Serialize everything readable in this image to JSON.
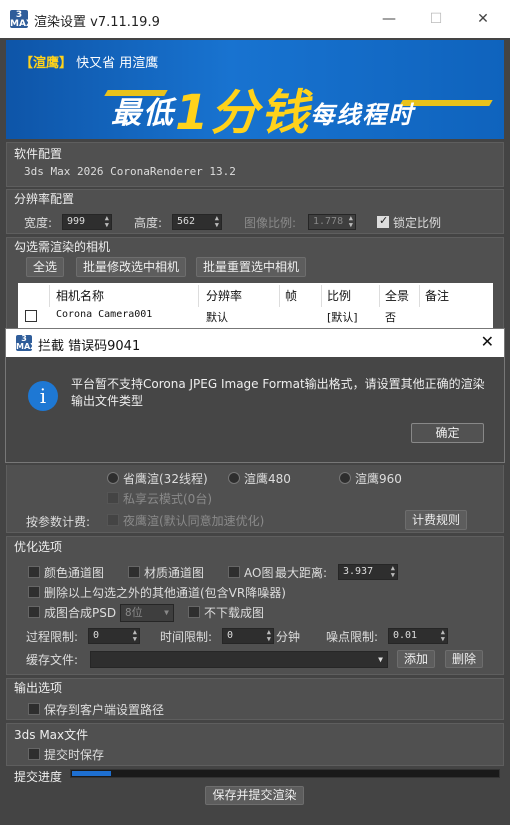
{
  "window": {
    "title": "渲染设置 v7.11.19.9",
    "minimize": "—",
    "maximize": "☐",
    "close": "✕",
    "logo": "3 MAX"
  },
  "banner": {
    "tagline_bracket": "【渲鹰】",
    "tagline": "快又省 用渲鹰",
    "main_prefix": "最低",
    "main_big": "1分钱",
    "main_suffix": "每线程时"
  },
  "software": {
    "title": "软件配置",
    "value": "3ds Max 2026  CoronaRenderer 13.2"
  },
  "resolution": {
    "title": "分辨率配置",
    "width_label": "宽度:",
    "width": "999",
    "height_label": "高度:",
    "height": "562",
    "ratio_label": "图像比例:",
    "ratio": "1.778",
    "lock_label": "锁定比例",
    "lock_checked": true
  },
  "cameras": {
    "title": "勾选需渲染的相机",
    "select_all": "全选",
    "batch_modify": "批量修改选中相机",
    "batch_reset": "批量重置选中相机",
    "columns": [
      "相机名称",
      "分辨率",
      "帧",
      "比例",
      "全景",
      "备注"
    ],
    "rows": [
      {
        "name": "Corona Camera001",
        "resolution": "默认",
        "frame": "",
        "ratio": "[默认]",
        "panorama": "否",
        "note": ""
      }
    ]
  },
  "dialog": {
    "title": "拦截 错误码9041",
    "message": "平台暂不支持Corona JPEG Image Format输出格式，请设置其他正确的渲染输出文件类型",
    "ok": "确定",
    "close": "✕",
    "logo": "3 MAX"
  },
  "render_options": {
    "opt1": "省鹰渲(32线程)",
    "opt2": "渲鹰480",
    "opt3": "渲鹰960",
    "private": "私享云模式(0台)",
    "billing_label": "按参数计费:",
    "night": "夜鹰渲(默认同意加速优化)",
    "rules": "计费规则"
  },
  "optimize": {
    "title": "优化选项",
    "color_channel": "颜色通道图",
    "material_channel": "材质通道图",
    "ao": "AO图",
    "max_distance_label": "最大距离:",
    "max_distance": "3.937",
    "delete_channels": "删除以上勾选之外的其他通道(包含VR降噪器)",
    "psd": "成图合成PSD",
    "bit": "8位",
    "no_download": "不下载成图",
    "process_label": "过程限制:",
    "process": "0",
    "time_label": "时间限制:",
    "time": "0",
    "minute": "分钟",
    "noise_label": "噪点限制:",
    "noise": "0.01",
    "cache_label": "缓存文件:",
    "cache_value": "",
    "add": "添加",
    "delete": "删除"
  },
  "output": {
    "title": "输出选项",
    "save_client": "保存到客户端设置路径"
  },
  "maxfile": {
    "title": "3ds Max文件",
    "save_on_submit": "提交时保存"
  },
  "submit": {
    "progress_label": "提交进度",
    "progress_fraction": 0.09,
    "button": "保存并提交渲染"
  }
}
